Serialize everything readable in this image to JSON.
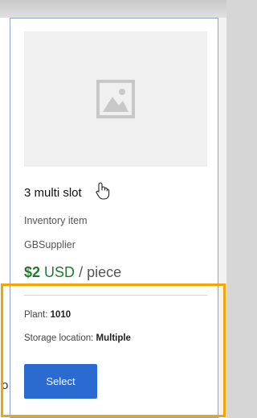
{
  "product": {
    "title": "3 multi slot",
    "type": "Inventory item",
    "supplier": "GBSupplier",
    "price": {
      "amount": "$2",
      "currency": "USD",
      "unit": "/ piece"
    },
    "details": {
      "plant_label": "Plant: ",
      "plant_value": "1010",
      "storage_label": "Storage location: ",
      "storage_value": "Multiple"
    },
    "select_label": "Select"
  },
  "edge_text": "o",
  "icons": {
    "image_placeholder": "image-icon",
    "cursor": "hand-pointer-icon"
  },
  "colors": {
    "price": "#1f7a2a",
    "button": "#2b6bd1",
    "highlight": "#f2a500",
    "card_border": "#8fa6c9"
  }
}
